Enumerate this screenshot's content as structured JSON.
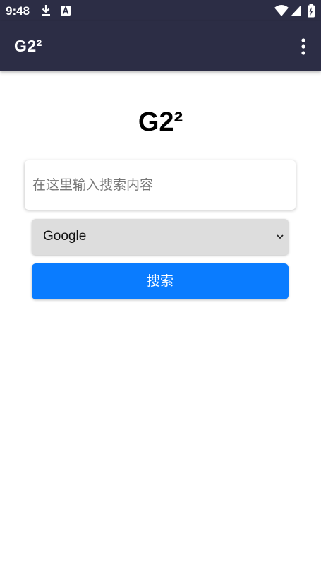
{
  "status_bar": {
    "time": "9:48",
    "icons": [
      "download-icon",
      "accessibility-icon",
      "wifi-icon",
      "signal-icon",
      "battery-charging-icon"
    ]
  },
  "app_bar": {
    "title": "G2²",
    "menu_icon": "more-vert-icon"
  },
  "main": {
    "heading": "G2²",
    "search_placeholder": "在这里输入搜索内容",
    "search_value": "",
    "engine_selected": "Google",
    "search_button_label": "搜索"
  },
  "colors": {
    "app_bar": "#2c2d45",
    "button": "#0a7cff",
    "select_bg": "#dddddd"
  }
}
